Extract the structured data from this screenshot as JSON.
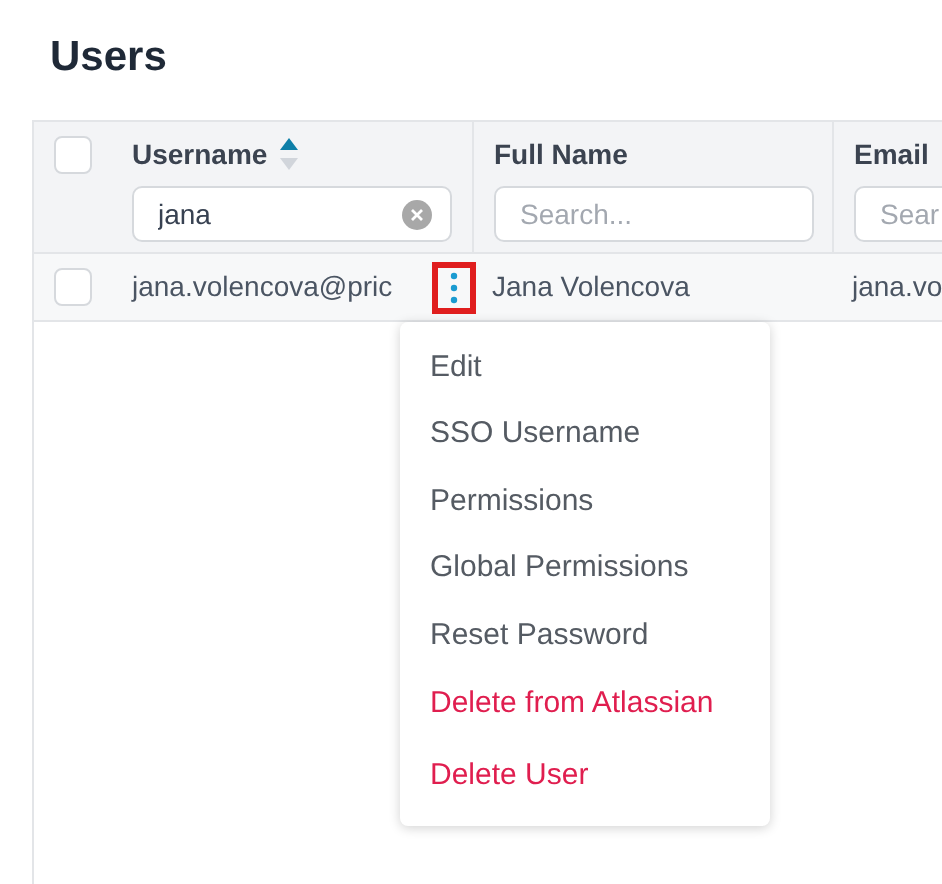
{
  "page_title": "Users",
  "table": {
    "select_all_checked": false,
    "columns": [
      {
        "label": "Username",
        "sorted_ascending": true,
        "filter": {
          "value": "jana"
        }
      },
      {
        "label": "Full Name",
        "sorted_ascending": false,
        "filter": {
          "placeholder": "Search..."
        }
      },
      {
        "label": "Email",
        "sorted_ascending": false,
        "filter": {
          "placeholder": "Sear"
        }
      }
    ],
    "rows": [
      {
        "checked": false,
        "cells": [
          "jana.volencova@pric",
          "Jana Volencova",
          "jana.vo"
        ],
        "actions_highlighted": true
      }
    ]
  },
  "row_menu": {
    "items": [
      {
        "label": "Edit",
        "kind": "normal"
      },
      {
        "label": "SSO Username",
        "kind": "normal"
      },
      {
        "label": "Permissions",
        "kind": "normal"
      },
      {
        "label": "Global Permissions",
        "kind": "normal"
      },
      {
        "label": "Reset Password",
        "kind": "normal"
      },
      {
        "label": "Delete from Atlassian",
        "kind": "danger"
      },
      {
        "label": "Delete User",
        "kind": "danger"
      }
    ]
  }
}
